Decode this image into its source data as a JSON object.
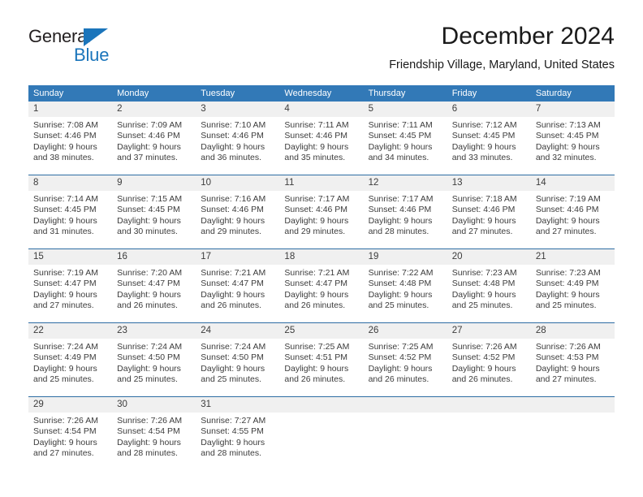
{
  "brand": {
    "name_top": "General",
    "name_bottom": "Blue",
    "triangle_color": "#1b75bb"
  },
  "header": {
    "title": "December 2024",
    "location": "Friendship Village, Maryland, United States"
  },
  "theme": {
    "header_blue": "#3279b7",
    "separator_blue": "#2e6da4",
    "day_number_band": "#f0f0f0",
    "text": "#3c3c3c"
  },
  "weekday_headers": [
    "Sunday",
    "Monday",
    "Tuesday",
    "Wednesday",
    "Thursday",
    "Friday",
    "Saturday"
  ],
  "weeks": [
    {
      "days": [
        {
          "num": "1",
          "sunrise": "Sunrise: 7:08 AM",
          "sunset": "Sunset: 4:46 PM",
          "daylight1": "Daylight: 9 hours",
          "daylight2": "and 38 minutes."
        },
        {
          "num": "2",
          "sunrise": "Sunrise: 7:09 AM",
          "sunset": "Sunset: 4:46 PM",
          "daylight1": "Daylight: 9 hours",
          "daylight2": "and 37 minutes."
        },
        {
          "num": "3",
          "sunrise": "Sunrise: 7:10 AM",
          "sunset": "Sunset: 4:46 PM",
          "daylight1": "Daylight: 9 hours",
          "daylight2": "and 36 minutes."
        },
        {
          "num": "4",
          "sunrise": "Sunrise: 7:11 AM",
          "sunset": "Sunset: 4:46 PM",
          "daylight1": "Daylight: 9 hours",
          "daylight2": "and 35 minutes."
        },
        {
          "num": "5",
          "sunrise": "Sunrise: 7:11 AM",
          "sunset": "Sunset: 4:45 PM",
          "daylight1": "Daylight: 9 hours",
          "daylight2": "and 34 minutes."
        },
        {
          "num": "6",
          "sunrise": "Sunrise: 7:12 AM",
          "sunset": "Sunset: 4:45 PM",
          "daylight1": "Daylight: 9 hours",
          "daylight2": "and 33 minutes."
        },
        {
          "num": "7",
          "sunrise": "Sunrise: 7:13 AM",
          "sunset": "Sunset: 4:45 PM",
          "daylight1": "Daylight: 9 hours",
          "daylight2": "and 32 minutes."
        }
      ]
    },
    {
      "days": [
        {
          "num": "8",
          "sunrise": "Sunrise: 7:14 AM",
          "sunset": "Sunset: 4:45 PM",
          "daylight1": "Daylight: 9 hours",
          "daylight2": "and 31 minutes."
        },
        {
          "num": "9",
          "sunrise": "Sunrise: 7:15 AM",
          "sunset": "Sunset: 4:45 PM",
          "daylight1": "Daylight: 9 hours",
          "daylight2": "and 30 minutes."
        },
        {
          "num": "10",
          "sunrise": "Sunrise: 7:16 AM",
          "sunset": "Sunset: 4:46 PM",
          "daylight1": "Daylight: 9 hours",
          "daylight2": "and 29 minutes."
        },
        {
          "num": "11",
          "sunrise": "Sunrise: 7:17 AM",
          "sunset": "Sunset: 4:46 PM",
          "daylight1": "Daylight: 9 hours",
          "daylight2": "and 29 minutes."
        },
        {
          "num": "12",
          "sunrise": "Sunrise: 7:17 AM",
          "sunset": "Sunset: 4:46 PM",
          "daylight1": "Daylight: 9 hours",
          "daylight2": "and 28 minutes."
        },
        {
          "num": "13",
          "sunrise": "Sunrise: 7:18 AM",
          "sunset": "Sunset: 4:46 PM",
          "daylight1": "Daylight: 9 hours",
          "daylight2": "and 27 minutes."
        },
        {
          "num": "14",
          "sunrise": "Sunrise: 7:19 AM",
          "sunset": "Sunset: 4:46 PM",
          "daylight1": "Daylight: 9 hours",
          "daylight2": "and 27 minutes."
        }
      ]
    },
    {
      "days": [
        {
          "num": "15",
          "sunrise": "Sunrise: 7:19 AM",
          "sunset": "Sunset: 4:47 PM",
          "daylight1": "Daylight: 9 hours",
          "daylight2": "and 27 minutes."
        },
        {
          "num": "16",
          "sunrise": "Sunrise: 7:20 AM",
          "sunset": "Sunset: 4:47 PM",
          "daylight1": "Daylight: 9 hours",
          "daylight2": "and 26 minutes."
        },
        {
          "num": "17",
          "sunrise": "Sunrise: 7:21 AM",
          "sunset": "Sunset: 4:47 PM",
          "daylight1": "Daylight: 9 hours",
          "daylight2": "and 26 minutes."
        },
        {
          "num": "18",
          "sunrise": "Sunrise: 7:21 AM",
          "sunset": "Sunset: 4:47 PM",
          "daylight1": "Daylight: 9 hours",
          "daylight2": "and 26 minutes."
        },
        {
          "num": "19",
          "sunrise": "Sunrise: 7:22 AM",
          "sunset": "Sunset: 4:48 PM",
          "daylight1": "Daylight: 9 hours",
          "daylight2": "and 25 minutes."
        },
        {
          "num": "20",
          "sunrise": "Sunrise: 7:23 AM",
          "sunset": "Sunset: 4:48 PM",
          "daylight1": "Daylight: 9 hours",
          "daylight2": "and 25 minutes."
        },
        {
          "num": "21",
          "sunrise": "Sunrise: 7:23 AM",
          "sunset": "Sunset: 4:49 PM",
          "daylight1": "Daylight: 9 hours",
          "daylight2": "and 25 minutes."
        }
      ]
    },
    {
      "days": [
        {
          "num": "22",
          "sunrise": "Sunrise: 7:24 AM",
          "sunset": "Sunset: 4:49 PM",
          "daylight1": "Daylight: 9 hours",
          "daylight2": "and 25 minutes."
        },
        {
          "num": "23",
          "sunrise": "Sunrise: 7:24 AM",
          "sunset": "Sunset: 4:50 PM",
          "daylight1": "Daylight: 9 hours",
          "daylight2": "and 25 minutes."
        },
        {
          "num": "24",
          "sunrise": "Sunrise: 7:24 AM",
          "sunset": "Sunset: 4:50 PM",
          "daylight1": "Daylight: 9 hours",
          "daylight2": "and 25 minutes."
        },
        {
          "num": "25",
          "sunrise": "Sunrise: 7:25 AM",
          "sunset": "Sunset: 4:51 PM",
          "daylight1": "Daylight: 9 hours",
          "daylight2": "and 26 minutes."
        },
        {
          "num": "26",
          "sunrise": "Sunrise: 7:25 AM",
          "sunset": "Sunset: 4:52 PM",
          "daylight1": "Daylight: 9 hours",
          "daylight2": "and 26 minutes."
        },
        {
          "num": "27",
          "sunrise": "Sunrise: 7:26 AM",
          "sunset": "Sunset: 4:52 PM",
          "daylight1": "Daylight: 9 hours",
          "daylight2": "and 26 minutes."
        },
        {
          "num": "28",
          "sunrise": "Sunrise: 7:26 AM",
          "sunset": "Sunset: 4:53 PM",
          "daylight1": "Daylight: 9 hours",
          "daylight2": "and 27 minutes."
        }
      ]
    },
    {
      "days": [
        {
          "num": "29",
          "sunrise": "Sunrise: 7:26 AM",
          "sunset": "Sunset: 4:54 PM",
          "daylight1": "Daylight: 9 hours",
          "daylight2": "and 27 minutes."
        },
        {
          "num": "30",
          "sunrise": "Sunrise: 7:26 AM",
          "sunset": "Sunset: 4:54 PM",
          "daylight1": "Daylight: 9 hours",
          "daylight2": "and 28 minutes."
        },
        {
          "num": "31",
          "sunrise": "Sunrise: 7:27 AM",
          "sunset": "Sunset: 4:55 PM",
          "daylight1": "Daylight: 9 hours",
          "daylight2": "and 28 minutes."
        },
        {
          "num": "",
          "sunrise": "",
          "sunset": "",
          "daylight1": "",
          "daylight2": ""
        },
        {
          "num": "",
          "sunrise": "",
          "sunset": "",
          "daylight1": "",
          "daylight2": ""
        },
        {
          "num": "",
          "sunrise": "",
          "sunset": "",
          "daylight1": "",
          "daylight2": ""
        },
        {
          "num": "",
          "sunrise": "",
          "sunset": "",
          "daylight1": "",
          "daylight2": ""
        }
      ]
    }
  ]
}
